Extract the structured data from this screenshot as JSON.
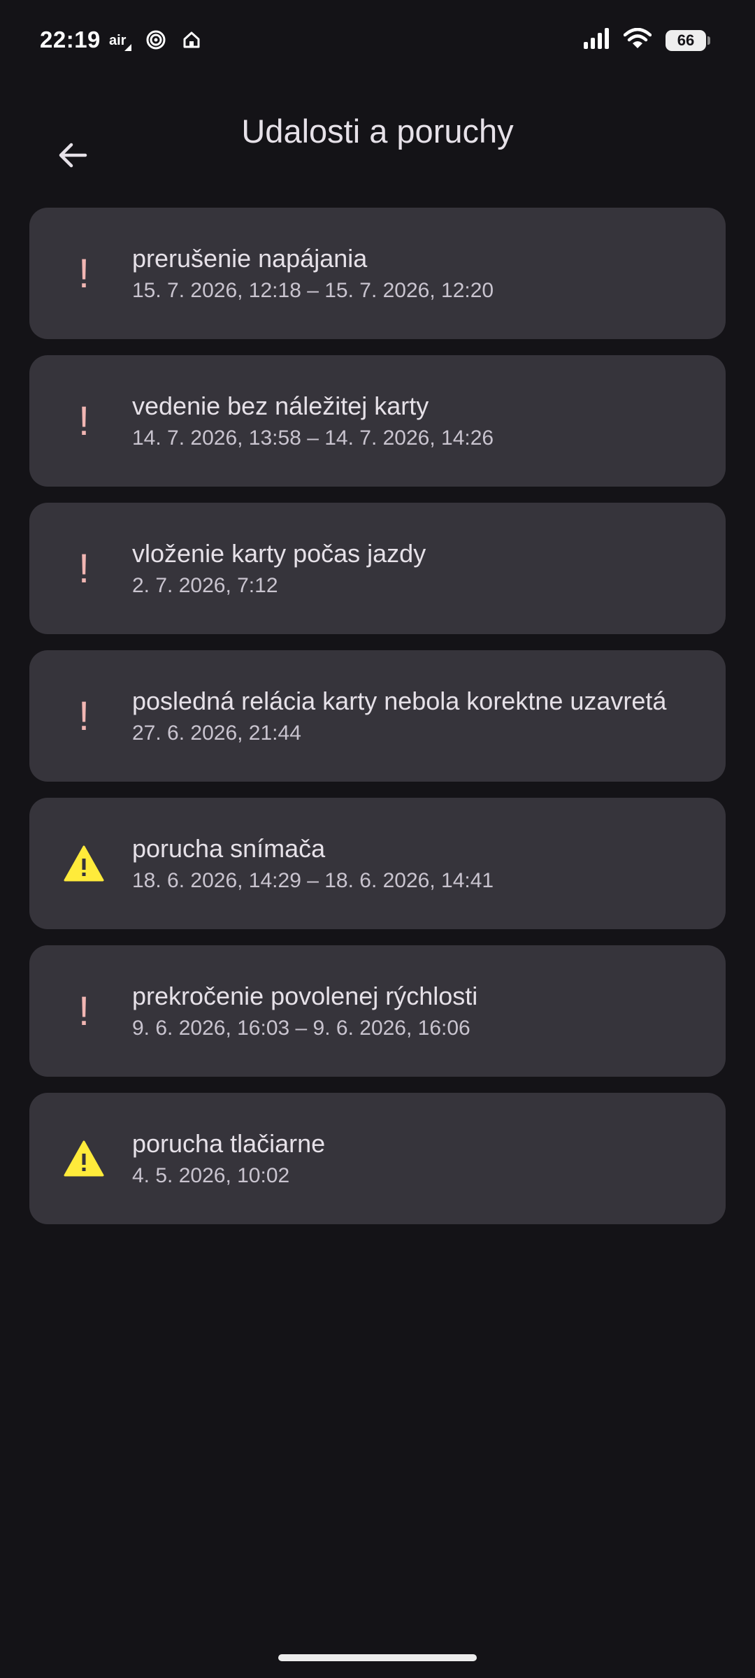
{
  "status_bar": {
    "time": "22:19",
    "air_label": "air",
    "battery": "66",
    "icons": [
      "air-icon",
      "hotspot-icon",
      "home-icon",
      "signal-icon",
      "wifi-icon",
      "battery-icon"
    ]
  },
  "app_bar": {
    "title": "Udalosti a poruchy",
    "back_icon": "arrow-back-icon"
  },
  "events": [
    {
      "icon": "error-icon",
      "glyph": "!",
      "title": "prerušenie napájania",
      "time": "15. 7. 2026, 12:18 – 15. 7. 2026, 12:20"
    },
    {
      "icon": "error-icon",
      "glyph": "!",
      "title": "vedenie bez náležitej karty",
      "time": "14. 7. 2026, 13:58 – 14. 7. 2026, 14:26"
    },
    {
      "icon": "error-icon",
      "glyph": "!",
      "title": "vloženie karty počas jazdy",
      "time": "2. 7. 2026, 7:12"
    },
    {
      "icon": "error-icon",
      "glyph": "!",
      "title": "posledná relácia karty nebola korektne uzavretá",
      "time": "27. 6. 2026, 21:44"
    },
    {
      "icon": "warning-icon",
      "glyph": "",
      "title": "porucha snímača",
      "time": "18. 6. 2026, 14:29 – 18. 6. 2026, 14:41"
    },
    {
      "icon": "error-icon",
      "glyph": "!",
      "title": "prekročenie povolenej rýchlosti",
      "time": "9. 6. 2026, 16:03 – 9. 6. 2026, 16:06"
    },
    {
      "icon": "warning-icon",
      "glyph": "",
      "title": "porucha tlačiarne",
      "time": "4. 5. 2026, 10:02"
    }
  ],
  "colors": {
    "background": "#141317",
    "card": "#36343b",
    "error": "#f2b6b3",
    "warning": "#ffeb3b"
  }
}
